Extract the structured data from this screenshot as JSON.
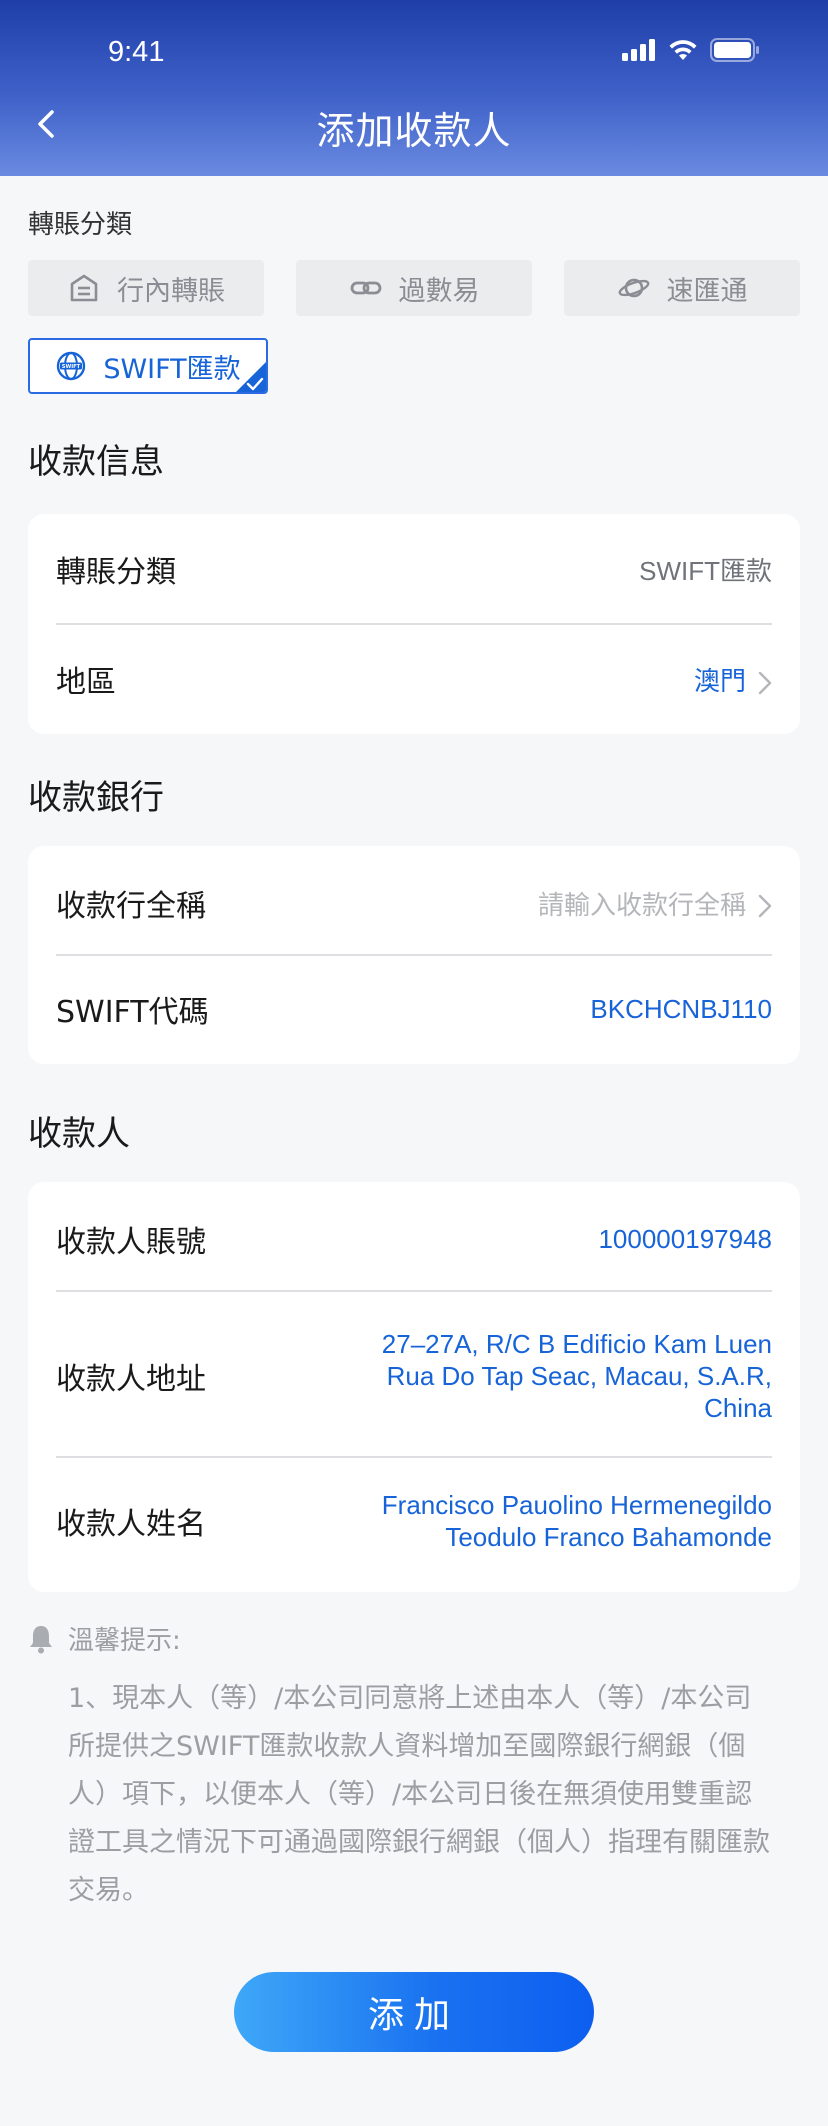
{
  "status_bar": {
    "time": "9:41"
  },
  "nav": {
    "title": "添加收款人"
  },
  "transfer_type": {
    "label": "轉賬分類",
    "options": [
      {
        "label": "行內轉賬",
        "icon": "bank-building-icon"
      },
      {
        "label": "過數易",
        "icon": "link-icon"
      },
      {
        "label": "速匯通",
        "icon": "planet-icon"
      },
      {
        "label": "SWIFT匯款",
        "icon": "swift-globe-icon",
        "selected": true
      }
    ]
  },
  "payee_info": {
    "title": "收款信息",
    "rows": [
      {
        "label": "轉賬分類",
        "value": "SWIFT匯款"
      },
      {
        "label": "地區",
        "value": "澳門"
      }
    ]
  },
  "payee_bank": {
    "title": "收款銀行",
    "rows": [
      {
        "label": "收款行全稱",
        "placeholder": "請輸入收款行全稱"
      },
      {
        "label": "SWIFT代碼",
        "value": "BKCHCNBJ110"
      }
    ]
  },
  "payee": {
    "title": "收款人",
    "rows": [
      {
        "label": "收款人賬號",
        "value": "100000197948"
      },
      {
        "label": "收款人地址",
        "value_lines": [
          "27–27A, R/C B Edificio Kam Luen",
          "Rua Do Tap Seac, Macau, S.A.R,",
          "China"
        ]
      },
      {
        "label": "收款人姓名",
        "value_lines": [
          "Francisco Pauolino Hermenegildo",
          "Teodulo Franco Bahamonde"
        ]
      }
    ]
  },
  "tips": {
    "title": "溫馨提示:",
    "lines": [
      "1、現本人（等）/本公司同意將上述由本人（等）/本公司",
      "所提供之SWIFT匯款收款人資料增加至國際銀行網銀（個",
      "人）項下，以便本人（等）/本公司日後在無須使用雙重認",
      "證工具之情況下可通過國際銀行網銀（個人）指理有關匯款",
      "交易。"
    ]
  },
  "submit": {
    "label": "添加"
  },
  "colors": {
    "accent": "#1763d8",
    "header_top": "#1f3ea8",
    "header_bottom": "#6a8ae0"
  }
}
